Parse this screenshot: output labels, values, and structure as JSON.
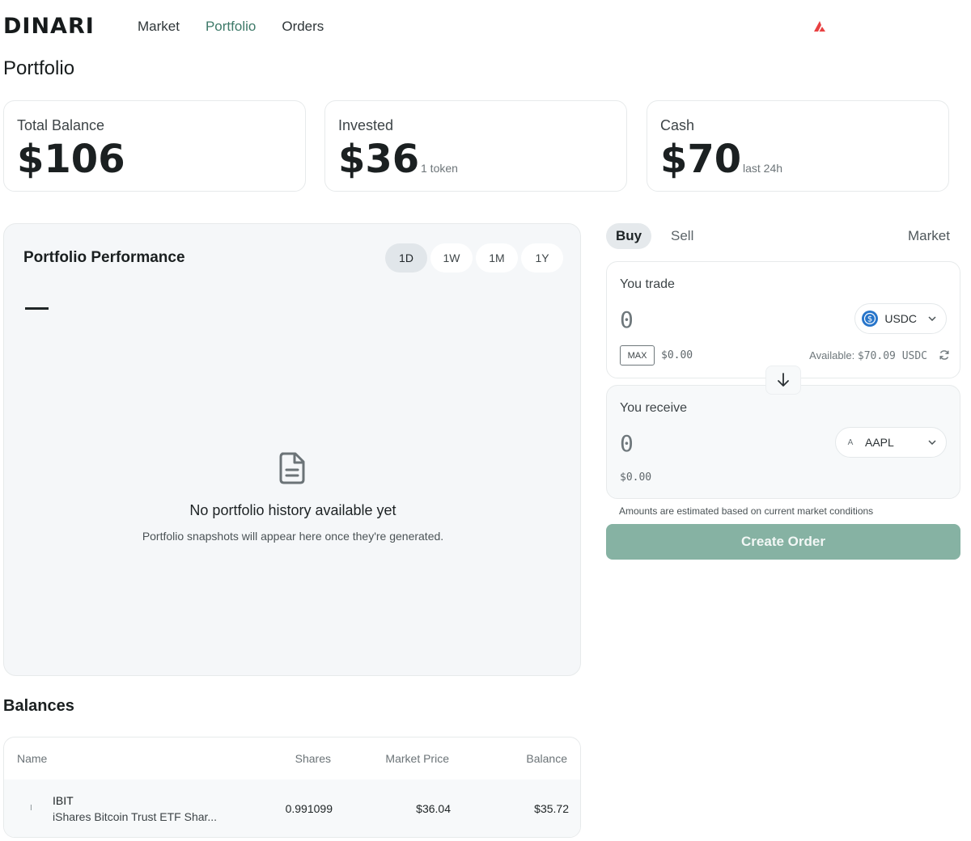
{
  "header": {
    "logo": "DINARI",
    "nav": [
      {
        "label": "Market",
        "active": false
      },
      {
        "label": "Portfolio",
        "active": true
      },
      {
        "label": "Orders",
        "active": false
      }
    ],
    "network_icon": "avalanche-icon",
    "accent_color": "#3e7a69"
  },
  "page": {
    "title": "Portfolio"
  },
  "stats": {
    "total": {
      "label": "Total Balance",
      "value": "$106"
    },
    "invested": {
      "label": "Invested",
      "value": "$36",
      "sub": "1 token"
    },
    "cash": {
      "label": "Cash",
      "value": "$70",
      "sub": "last 24h"
    }
  },
  "performance": {
    "title": "Portfolio Performance",
    "ranges": [
      "1D",
      "1W",
      "1M",
      "1Y"
    ],
    "active_range": "1D",
    "change_value": "—",
    "empty_icon": "document-icon",
    "empty_title": "No portfolio history available yet",
    "empty_subtitle": "Portfolio snapshots will appear here once they're generated."
  },
  "balances": {
    "title": "Balances",
    "columns": [
      "Name",
      "Shares",
      "Market Price",
      "Balance"
    ],
    "rows": [
      {
        "icon": "I",
        "symbol": "IBIT",
        "name": "iShares Bitcoin Trust ETF Shar...",
        "shares": "0.991099",
        "price": "$36.04",
        "balance": "$35.72"
      }
    ]
  },
  "trade": {
    "tabs": [
      "Buy",
      "Sell"
    ],
    "active_tab": "Buy",
    "order_type": "Market",
    "you_trade": {
      "label": "You trade",
      "amount": "0",
      "token": "USDC",
      "max_label": "MAX",
      "usd_value": "$0.00",
      "available_label": "Available:",
      "available_value": "$70.09 USDC"
    },
    "you_receive": {
      "label": "You receive",
      "amount": "0",
      "token": "AAPL",
      "token_icon": "A",
      "usd_value": "$0.00"
    },
    "note": "Amounts are estimated based on current market conditions",
    "submit_label": "Create Order",
    "submit_color": "#86b2a3"
  }
}
